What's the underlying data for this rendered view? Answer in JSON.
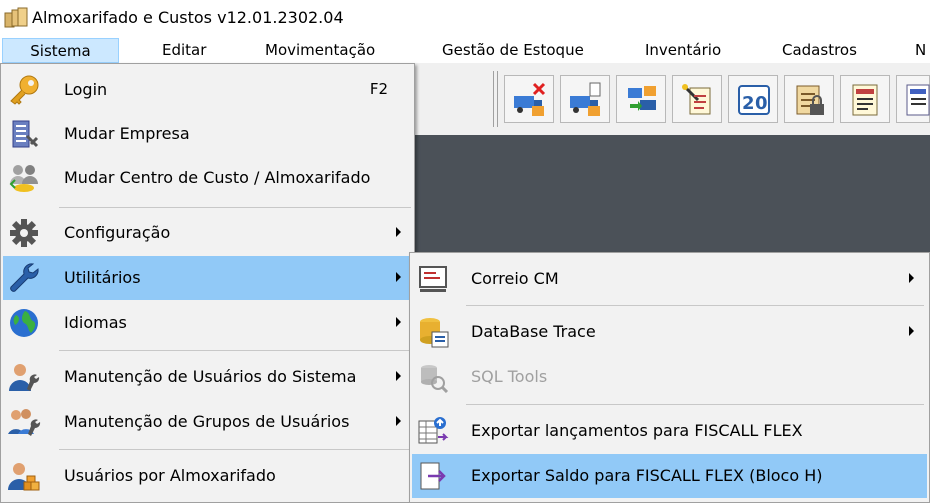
{
  "window": {
    "title": "Almoxarifado e Custos v12.01.2302.04",
    "app_icon": "boxes-icon"
  },
  "menubar": [
    {
      "label": "Sistema",
      "active": true
    },
    {
      "label": "Editar"
    },
    {
      "label": "Movimentação"
    },
    {
      "label": "Gestão de Estoque"
    },
    {
      "label": "Inventário"
    },
    {
      "label": "Cadastros"
    },
    {
      "label": "N"
    }
  ],
  "toolbar": {
    "buttons": [
      {
        "icon": "truck-cancel-icon"
      },
      {
        "icon": "truck-document-icon"
      },
      {
        "icon": "truck-transfer-icon"
      },
      {
        "icon": "wand-document-icon"
      },
      {
        "icon": "counter-20-icon"
      },
      {
        "icon": "clipboard-lock-icon"
      },
      {
        "icon": "report-list-icon"
      },
      {
        "icon": "report-icon"
      }
    ]
  },
  "sistema_menu": {
    "items": [
      {
        "label": "Login",
        "shortcut": "F2",
        "icon": "key-icon"
      },
      {
        "label": "Mudar Empresa",
        "icon": "building-icon"
      },
      {
        "label": "Mudar Centro de Custo / Almoxarifado",
        "icon": "people-exchange-icon"
      },
      {
        "label": "Configuração",
        "icon": "gear-icon",
        "submenu": true
      },
      {
        "label": "Utilitários",
        "icon": "wrench-icon",
        "submenu": true,
        "selected": true
      },
      {
        "label": "Idiomas",
        "icon": "globe-icon",
        "submenu": true
      },
      {
        "label": "Manutenção de Usuários do Sistema",
        "icon": "user-wrench-icon",
        "submenu": true
      },
      {
        "label": "Manutenção de Grupos de Usuários",
        "icon": "group-wrench-icon",
        "submenu": true
      },
      {
        "label": "Usuários por Almoxarifado",
        "icon": "user-boxes-icon"
      }
    ]
  },
  "utilitarios_menu": {
    "items": [
      {
        "label": "Correio CM",
        "icon": "mail-screen-icon",
        "submenu": true
      },
      {
        "label": "DataBase Trace",
        "icon": "database-trace-icon",
        "submenu": true
      },
      {
        "label": "SQL Tools",
        "icon": "sql-tools-icon",
        "submenu": true,
        "disabled": true
      },
      {
        "label": "Exportar lançamentos para FISCALL FLEX",
        "icon": "export-table-icon"
      },
      {
        "label": "Exportar Saldo para FISCALL FLEX (Bloco H)",
        "icon": "export-arrow-icon",
        "selected": true
      }
    ]
  },
  "colors": {
    "selection": "#91c9f7",
    "menubar_active": "#cce8ff",
    "workspace": "#4b5158",
    "menu_bg": "#f2f2f2"
  }
}
